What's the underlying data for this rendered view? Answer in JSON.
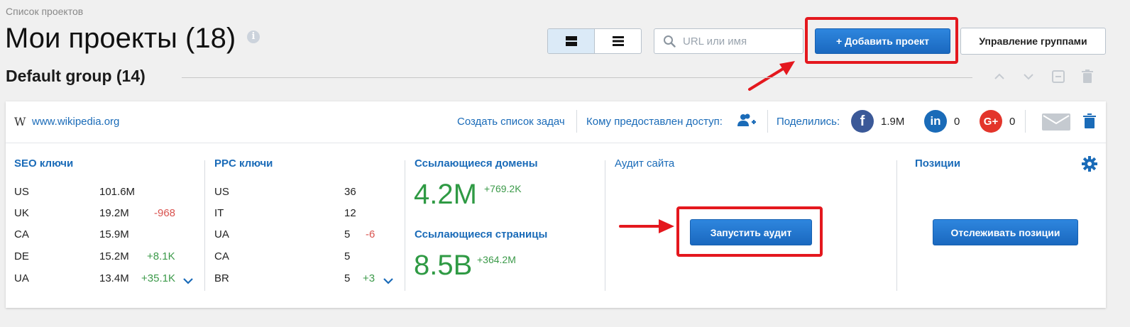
{
  "breadcrumb": "Список проектов",
  "page_title": "Мои проекты (18)",
  "search": {
    "placeholder": "URL или имя"
  },
  "toolbar": {
    "add_project_label": "+ Добавить проект",
    "manage_groups_label": "Управление группами"
  },
  "group": {
    "title": "Default group (14)"
  },
  "project": {
    "url": "www.wikipedia.org",
    "create_tasks_label": "Создать список задач",
    "access_label": "Кому предоставлен доступ:",
    "shared_label": "Поделились:",
    "facebook_count": "1.9M",
    "linkedin_count": "0",
    "google_count": "0"
  },
  "seo": {
    "title": "SEO ключи",
    "rows": [
      {
        "country": "US",
        "value": "101.6M",
        "delta": ""
      },
      {
        "country": "UK",
        "value": "19.2M",
        "delta": "-968"
      },
      {
        "country": "CA",
        "value": "15.9M",
        "delta": ""
      },
      {
        "country": "DE",
        "value": "15.2M",
        "delta": "+8.1K"
      },
      {
        "country": "UA",
        "value": "13.4M",
        "delta": "+35.1K"
      }
    ]
  },
  "ppc": {
    "title": "PPC ключи",
    "rows": [
      {
        "country": "US",
        "value": "36",
        "delta": ""
      },
      {
        "country": "IT",
        "value": "12",
        "delta": ""
      },
      {
        "country": "UA",
        "value": "5",
        "delta": "-6"
      },
      {
        "country": "CA",
        "value": "5",
        "delta": ""
      },
      {
        "country": "BR",
        "value": "5",
        "delta": "+3"
      }
    ]
  },
  "backlinks": {
    "domains_title": "Ссылающиеся домены",
    "domains_value": "4.2M",
    "domains_delta": "+769.2K",
    "pages_title": "Ссылающиеся страницы",
    "pages_value": "8.5B",
    "pages_delta": "+364.2M"
  },
  "audit": {
    "title": "Аудит сайта",
    "button_label": "Запустить аудит"
  },
  "positions": {
    "title": "Позиции",
    "button_label": "Отслеживать позиции"
  },
  "colors": {
    "accent": "#1a6bb8",
    "highlight_red": "#e4181e",
    "positive": "#3c9a4a",
    "negative": "#d9534f"
  }
}
